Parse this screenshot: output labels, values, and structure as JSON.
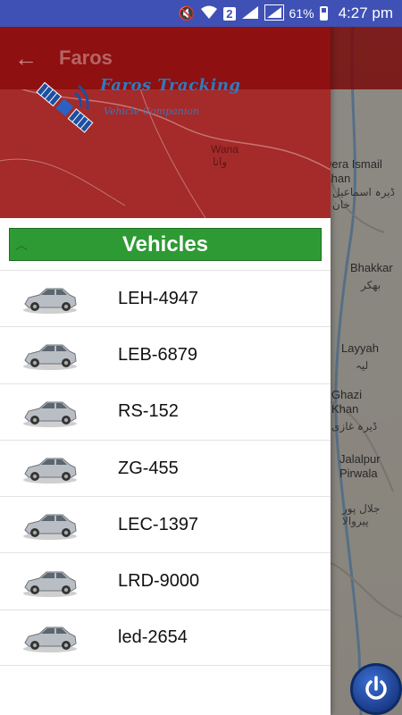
{
  "status_bar": {
    "sim_slot": "2",
    "battery_percent": "61%",
    "time": "4:27 pm"
  },
  "app_bar": {
    "title": "Faros",
    "back_icon": "arrow-left-icon"
  },
  "logo": {
    "line1": "Faros Tracking",
    "line2": "Vehicle Companion"
  },
  "map": {
    "places": [
      {
        "name": "Wana",
        "urdu": "وانا"
      },
      {
        "name": "Dera Ismail Khan",
        "urdu": "ڈیرہ اسماعیل خان"
      },
      {
        "name": "Bhakkar",
        "urdu": "بھکر"
      },
      {
        "name": "Layyah",
        "urdu": "لیہ"
      },
      {
        "name": "Ghazi Khan",
        "urdu": "ڈیرہ غازی"
      },
      {
        "name": "Jalalpur Pirwala",
        "urdu": "جلال پور پیروالا"
      }
    ]
  },
  "drawer": {
    "section_title": "Vehicles",
    "vehicles": [
      {
        "plate": "LEH-4947"
      },
      {
        "plate": "LEB-6879"
      },
      {
        "plate": "RS-152"
      },
      {
        "plate": "ZG-455"
      },
      {
        "plate": "LEC-1397"
      },
      {
        "plate": "LRD-9000"
      },
      {
        "plate": "led-2654"
      }
    ]
  },
  "colors": {
    "status_bar": "#3f51b5",
    "header": "#a52a2a",
    "section_bar": "#2e9a34",
    "logo_text": "#2e7bbf"
  }
}
